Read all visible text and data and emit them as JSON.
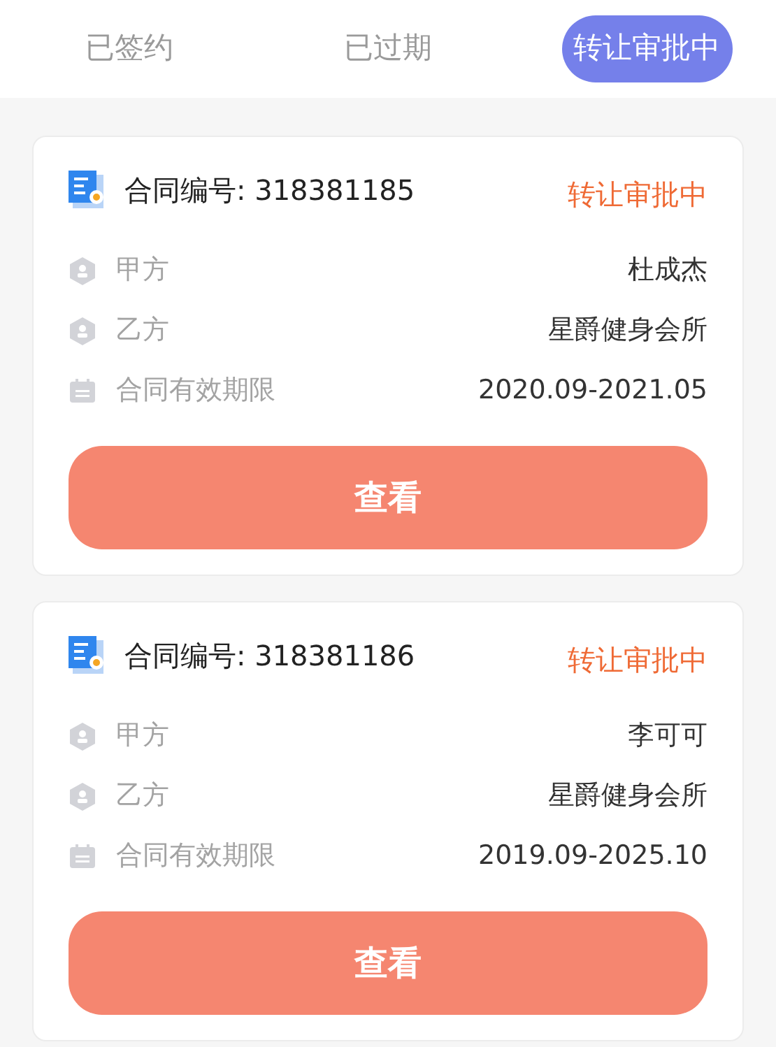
{
  "tabs": [
    {
      "label": "已签约",
      "selected": false
    },
    {
      "label": "已过期",
      "selected": false
    },
    {
      "label": "转让审批中",
      "selected": true
    }
  ],
  "contracts": [
    {
      "title": "合同编号: 318381185",
      "status": "转让审批中",
      "rows": [
        {
          "kind": "party",
          "label": "甲方",
          "value": "杜成杰"
        },
        {
          "kind": "party",
          "label": "乙方",
          "value": "星爵健身会所"
        },
        {
          "kind": "date",
          "label": "合同有效期限",
          "value": "2020.09-2021.05"
        }
      ],
      "button": "查看"
    },
    {
      "title": "合同编号: 318381186",
      "status": "转让审批中",
      "rows": [
        {
          "kind": "party",
          "label": "甲方",
          "value": "李可可"
        },
        {
          "kind": "party",
          "label": "乙方",
          "value": "星爵健身会所"
        },
        {
          "kind": "date",
          "label": "合同有效期限",
          "value": "2019.09-2025.10"
        }
      ],
      "button": "查看"
    }
  ]
}
